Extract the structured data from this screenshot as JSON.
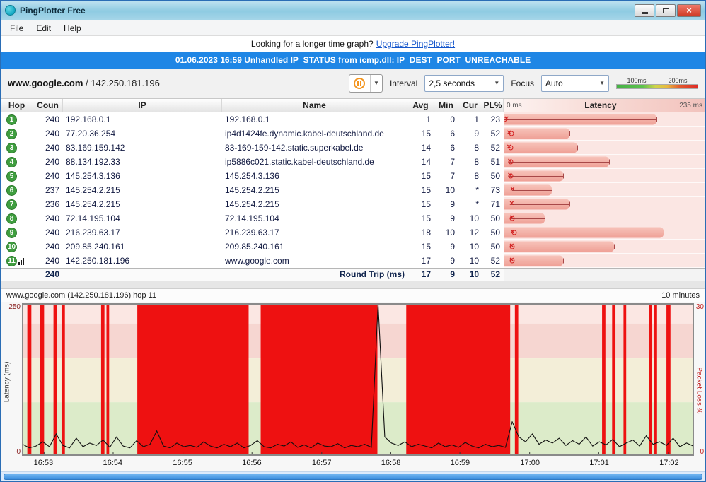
{
  "window": {
    "title": "PingPlotter Free"
  },
  "menu": {
    "items": [
      "File",
      "Edit",
      "Help"
    ]
  },
  "banner": {
    "prefix": "Looking for a longer time graph?",
    "link": "Upgrade PingPlotter!"
  },
  "alert": {
    "text": "01.06.2023 16:59 Unhandled IP_STATUS from icmp.dll: IP_DEST_PORT_UNREACHABLE"
  },
  "toolbar": {
    "host": "www.google.com",
    "separator": " / ",
    "ip": "142.250.181.196",
    "interval_label": "Interval",
    "interval_value": "2,5 seconds",
    "focus_label": "Focus",
    "focus_value": "Auto",
    "scale_low": "100ms",
    "scale_high": "200ms"
  },
  "table": {
    "headers": {
      "hop": "Hop",
      "count": "Coun",
      "ip": "IP",
      "name": "Name",
      "avg": "Avg",
      "min": "Min",
      "cur": "Cur",
      "pl": "PL%",
      "lat_min": "0 ms",
      "lat_title": "Latency",
      "lat_max": "235 ms"
    },
    "latency_scale_ms": 235,
    "rows": [
      {
        "hop": "1",
        "count": "240",
        "ip": "192.168.0.1",
        "name": "192.168.0.1",
        "avg": "1",
        "min": "0",
        "cur": "1",
        "pl": "23",
        "min_ms": 0,
        "max_ms": 178,
        "cur_ms": 1,
        "focus": false
      },
      {
        "hop": "2",
        "count": "240",
        "ip": "77.20.36.254",
        "name": "ip4d1424fe.dynamic.kabel-deutschland.de",
        "avg": "15",
        "min": "6",
        "cur": "9",
        "pl": "52",
        "min_ms": 6,
        "max_ms": 77,
        "cur_ms": 9,
        "focus": false
      },
      {
        "hop": "3",
        "count": "240",
        "ip": "83.169.159.142",
        "name": "83-169-159-142.static.superkabel.de",
        "avg": "14",
        "min": "6",
        "cur": "8",
        "pl": "52",
        "min_ms": 6,
        "max_ms": 86,
        "cur_ms": 8,
        "focus": false
      },
      {
        "hop": "4",
        "count": "240",
        "ip": "88.134.192.33",
        "name": "ip5886c021.static.kabel-deutschland.de",
        "avg": "14",
        "min": "7",
        "cur": "8",
        "pl": "51",
        "min_ms": 7,
        "max_ms": 123,
        "cur_ms": 8,
        "focus": false
      },
      {
        "hop": "5",
        "count": "240",
        "ip": "145.254.3.136",
        "name": "145.254.3.136",
        "avg": "15",
        "min": "7",
        "cur": "8",
        "pl": "50",
        "min_ms": 7,
        "max_ms": 69,
        "cur_ms": 8,
        "focus": false
      },
      {
        "hop": "6",
        "count": "237",
        "ip": "145.254.2.215",
        "name": "145.254.2.215",
        "avg": "15",
        "min": "10",
        "cur": "*",
        "pl": "73",
        "min_ms": 10,
        "max_ms": 56,
        "cur_ms": null,
        "focus": false
      },
      {
        "hop": "7",
        "count": "236",
        "ip": "145.254.2.215",
        "name": "145.254.2.215",
        "avg": "15",
        "min": "9",
        "cur": "*",
        "pl": "71",
        "min_ms": 9,
        "max_ms": 77,
        "cur_ms": null,
        "focus": false
      },
      {
        "hop": "8",
        "count": "240",
        "ip": "72.14.195.104",
        "name": "72.14.195.104",
        "avg": "15",
        "min": "9",
        "cur": "10",
        "pl": "50",
        "min_ms": 9,
        "max_ms": 48,
        "cur_ms": 10,
        "focus": false
      },
      {
        "hop": "9",
        "count": "240",
        "ip": "216.239.63.17",
        "name": "216.239.63.17",
        "avg": "18",
        "min": "10",
        "cur": "12",
        "pl": "50",
        "min_ms": 10,
        "max_ms": 186,
        "cur_ms": 12,
        "focus": false
      },
      {
        "hop": "10",
        "count": "240",
        "ip": "209.85.240.161",
        "name": "209.85.240.161",
        "avg": "15",
        "min": "9",
        "cur": "10",
        "pl": "50",
        "min_ms": 9,
        "max_ms": 129,
        "cur_ms": 10,
        "focus": false
      },
      {
        "hop": "11",
        "count": "240",
        "ip": "142.250.181.196",
        "name": "www.google.com",
        "avg": "17",
        "min": "9",
        "cur": "10",
        "pl": "52",
        "min_ms": 9,
        "max_ms": 69,
        "cur_ms": 10,
        "focus": true
      }
    ],
    "footer": {
      "count": "240",
      "label": "Round Trip (ms)",
      "avg": "17",
      "min": "9",
      "cur": "10",
      "pl": "52"
    }
  },
  "graph": {
    "title": "www.google.com (142.250.181.196) hop 11",
    "range_label": "10 minutes",
    "y_left_label": "Latency (ms)",
    "y_left_max": "250",
    "y_left_min": "0",
    "y_right_label": "Packet Loss %",
    "y_right_max": "30",
    "y_right_min": "0",
    "scale_ms": 250,
    "loss_color": "#ee1111",
    "bands": [
      {
        "top": 0.0,
        "bottom": 0.13,
        "color": "#fbe7e3"
      },
      {
        "top": 0.13,
        "bottom": 0.36,
        "color": "#f6d6d1"
      },
      {
        "top": 0.36,
        "bottom": 0.65,
        "color": "#f3eed8"
      },
      {
        "top": 0.65,
        "bottom": 1.0,
        "color": "#dcebc9"
      }
    ],
    "x_ticks": [
      {
        "label": "16:53",
        "f": 0.032
      },
      {
        "label": "16:54",
        "f": 0.135
      },
      {
        "label": "16:55",
        "f": 0.239
      },
      {
        "label": "16:56",
        "f": 0.342
      },
      {
        "label": "16:57",
        "f": 0.446
      },
      {
        "label": "16:58",
        "f": 0.549
      },
      {
        "label": "16:59",
        "f": 0.652
      },
      {
        "label": "17:00",
        "f": 0.756
      },
      {
        "label": "17:01",
        "f": 0.859
      },
      {
        "label": "17:02",
        "f": 0.963
      }
    ],
    "loss_bars": [
      {
        "x": 0.007,
        "w": 0.006
      },
      {
        "x": 0.026,
        "w": 0.006
      },
      {
        "x": 0.046,
        "w": 0.005
      },
      {
        "x": 0.058,
        "w": 0.005
      },
      {
        "x": 0.117,
        "w": 0.005
      },
      {
        "x": 0.125,
        "w": 0.004
      },
      {
        "x": 0.171,
        "w": 0.166
      },
      {
        "x": 0.355,
        "w": 0.174
      },
      {
        "x": 0.572,
        "w": 0.155
      },
      {
        "x": 0.734,
        "w": 0.005
      },
      {
        "x": 0.864,
        "w": 0.005
      },
      {
        "x": 0.879,
        "w": 0.005
      },
      {
        "x": 0.896,
        "w": 0.004
      },
      {
        "x": 0.934,
        "w": 0.004
      },
      {
        "x": 0.942,
        "w": 0.004
      },
      {
        "x": 0.96,
        "w": 0.006
      }
    ],
    "latency_values": [
      18,
      12,
      15,
      22,
      14,
      35,
      16,
      12,
      28,
      14,
      20,
      16,
      25,
      13,
      30,
      15,
      12,
      24,
      14,
      18,
      40,
      15,
      12,
      20,
      14,
      16,
      13,
      22,
      15,
      12,
      18,
      14,
      20,
      12,
      16,
      24,
      14,
      12,
      18,
      15,
      22,
      13,
      17,
      12,
      20,
      15,
      14,
      19,
      12,
      16,
      14,
      18,
      13,
      250,
      30,
      20,
      16,
      22,
      14,
      18,
      15,
      12,
      20,
      14,
      17,
      13,
      21,
      15,
      12,
      18,
      14,
      16,
      13,
      55,
      30,
      22,
      35,
      18,
      25,
      20,
      28,
      16,
      24,
      18,
      30,
      15,
      22,
      17,
      26,
      14,
      20,
      25,
      15,
      32,
      18,
      22,
      16,
      28,
      14,
      20,
      15
    ]
  }
}
